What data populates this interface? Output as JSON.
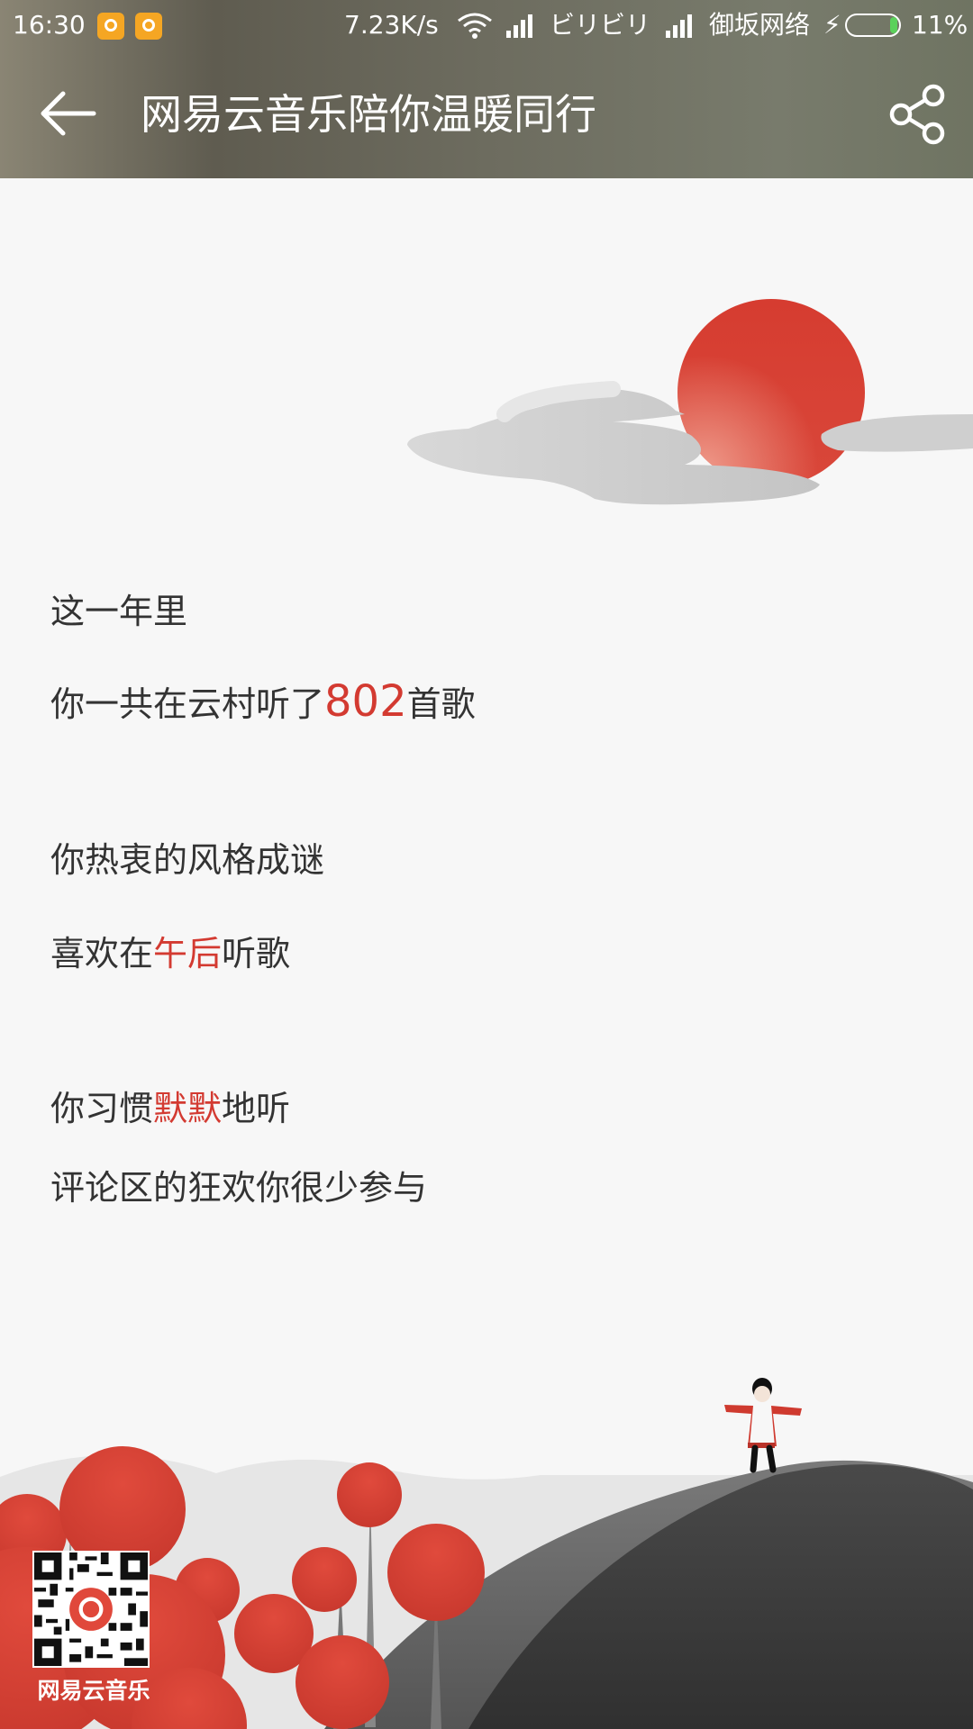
{
  "status_bar": {
    "time": "16:30",
    "net_speed": "7.23K/s",
    "carrier1": "ビリビリ",
    "carrier2": "御坂网络",
    "battery": "11%",
    "battery_level": 0.11,
    "accent": "#5bd15b"
  },
  "header": {
    "title": "网易云音乐陪你温暖同行",
    "back_icon": "arrow-left-icon",
    "share_icon": "share-icon"
  },
  "report": {
    "line1": "这一年里",
    "line2_prefix": "你一共在云村听了",
    "song_count": "802",
    "line2_suffix": "首歌",
    "line3": "你热衷的风格成谜",
    "line4_prefix": "喜欢在",
    "line4_highlight": "午后",
    "line4_suffix": "听歌",
    "line5_prefix": "你习惯",
    "line5_highlight": "默默",
    "line5_suffix": "地听",
    "line6": "评论区的狂欢你很少参与",
    "highlight_color": "#d33a31"
  },
  "footer": {
    "brand": "网易云音乐",
    "qr_icon": "qr-code-icon"
  }
}
